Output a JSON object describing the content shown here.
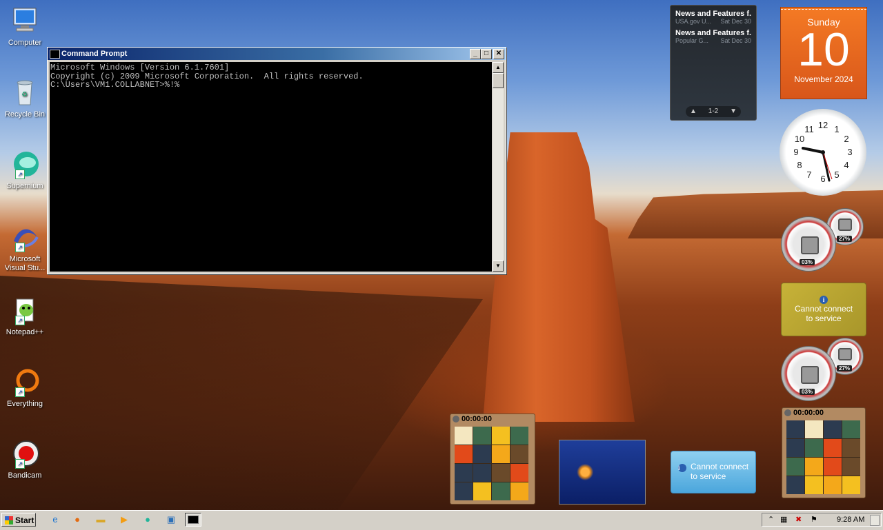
{
  "desktop": {
    "icons": [
      {
        "label": "Computer",
        "icon": "computer-icon"
      },
      {
        "label": "Recycle Bin",
        "icon": "recycle-bin-icon"
      },
      {
        "label": "Supernium",
        "icon": "supernium-icon"
      },
      {
        "label": "Microsoft Visual Stu...",
        "icon": "visual-studio-icon"
      },
      {
        "label": "Notepad++",
        "icon": "notepadpp-icon"
      },
      {
        "label": "Everything",
        "icon": "everything-icon"
      },
      {
        "label": "Bandicam",
        "icon": "bandicam-icon"
      }
    ]
  },
  "cmd": {
    "title": "Command Prompt",
    "lines": [
      "Microsoft Windows [Version 6.1.7601]",
      "Copyright (c) 2009 Microsoft Corporation.  All rights reserved.",
      "",
      "C:\\Users\\VM1.COLLABNET>%!%"
    ],
    "minimize": "_",
    "maximize": "□",
    "close": "✕"
  },
  "news": {
    "items": [
      {
        "headline": "News and Features f...",
        "source": "USA.gov U...",
        "date": "Sat Dec 30"
      },
      {
        "headline": "News and Features f...",
        "source": "Popular G...",
        "date": "Sat Dec 30"
      }
    ],
    "pager": "1-2"
  },
  "calendar": {
    "weekday": "Sunday",
    "day": "10",
    "month_year": "November 2024"
  },
  "clock": {
    "numbers": [
      "12",
      "1",
      "2",
      "3",
      "4",
      "5",
      "6",
      "7",
      "8",
      "9",
      "10",
      "11"
    ]
  },
  "meters": [
    {
      "cpu": "03%",
      "mem": "27%"
    },
    {
      "cpu": "03%",
      "mem": "27%"
    }
  ],
  "weather": {
    "message1": "Cannot connect to service",
    "message2": "Cannot connect to service"
  },
  "puzzles": [
    {
      "timer": "00:00:00"
    },
    {
      "timer": "00:00:00"
    }
  ],
  "taskbar": {
    "start": "Start",
    "time": "9:28 AM",
    "quick": [
      "ie-icon",
      "firefox-icon",
      "explorer-folder-icon",
      "media-player-icon",
      "supernium-icon",
      "remote-desktop-icon",
      "cmd-icon"
    ]
  },
  "colors": {
    "titlebar": "#0a246a",
    "calendar": "#f47a24",
    "console_bg": "#000000",
    "console_fg": "#c0c0c0"
  }
}
